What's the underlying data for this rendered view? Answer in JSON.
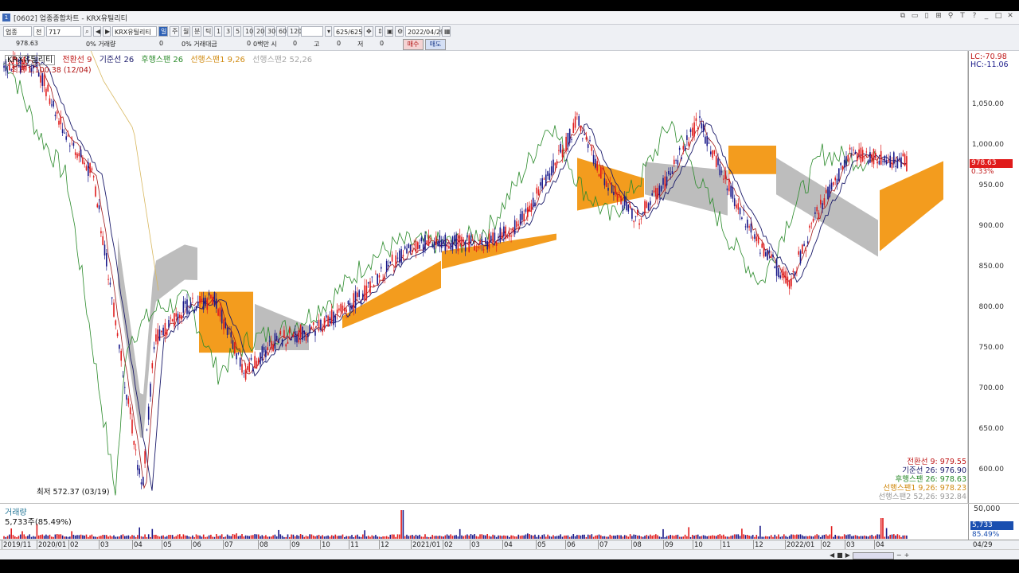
{
  "window": {
    "title": "[0602] 업종종합차트 - KRX유틸리티",
    "icon_text": "1"
  },
  "toolbar": {
    "market": "업종",
    "type": "전",
    "code": "717",
    "name": "KRX유틸리티",
    "period_buttons": [
      "일",
      "주",
      "월",
      "분",
      "틱",
      "1",
      "3",
      "5",
      "10",
      "20",
      "30",
      "60",
      "120"
    ],
    "count_display": "625/625",
    "date": "2022/04/29"
  },
  "toolbar2": {
    "price": "978.63",
    "vol_pct": "0% 거래량",
    "vol": "0",
    "amt_pct": "0% 거래대금",
    "amt": "0",
    "unit_label": "0백만 시",
    "open": "0",
    "high_label": "고",
    "high": "0",
    "low_label": "저",
    "low": "0",
    "buy": "매수",
    "sell": "매도"
  },
  "legend": {
    "name": "KRX유틸리티",
    "tenkan": "전환선 9",
    "kijun": "기준선 26",
    "chikou": "후행스팬 26",
    "senkou1": "선행스팬1 9,26",
    "senkou2": "선행스팬2 52,26"
  },
  "annotations": {
    "high": "최고 1,100.38 (12/04)",
    "low": "최저 572.37 (03/19)"
  },
  "right_top": {
    "lc": "LC:-70.98",
    "hc": "HC:-11.06"
  },
  "price_tag": {
    "value": "978.63",
    "pct": "0.33%"
  },
  "y_ticks": [
    "1,050.00",
    "1,000.00",
    "950.00",
    "900.00",
    "850.00",
    "800.00",
    "750.00",
    "700.00",
    "650.00",
    "600.00"
  ],
  "indicator_values": [
    {
      "text": "전환선 9: 979.55",
      "color": "#c01818"
    },
    {
      "text": "기준선 26: 976.90",
      "color": "#1a1a6a"
    },
    {
      "text": "후행스팬 26: 978.63",
      "color": "#2a8a2a"
    },
    {
      "text": "선행스팬1 9,26: 978.23",
      "color": "#d08a10"
    },
    {
      "text": "선행스팬2 52,26: 932.84",
      "color": "#9a9a9a"
    }
  ],
  "volume": {
    "title": "거래량",
    "value_text": "5,733주(85.49%)",
    "y_tick": "50,000",
    "box": "5,733",
    "pct": "85.49%"
  },
  "x_labels": [
    "2019/11",
    "2020/01",
    "02",
    "03",
    "04",
    "05",
    "06",
    "07",
    "08",
    "09",
    "10",
    "11",
    "12",
    "2021/01",
    "02",
    "03",
    "04",
    "05",
    "06",
    "07",
    "08",
    "09",
    "10",
    "11",
    "12",
    "2022/01",
    "02",
    "03",
    "04"
  ],
  "x_right": "04/29",
  "colors": {
    "up": "#e01b1b",
    "down": "#1a1a8a",
    "cloud_up": "#f39c1e",
    "cloud_down": "#bdbdbd",
    "chikou": "#2a8a2a",
    "kijun": "#1a1a6a",
    "senkou1": "#d8b860"
  },
  "chart_data": {
    "type": "line",
    "title": "KRX유틸리티",
    "x_range": [
      "2019/11",
      "2022/04/29"
    ],
    "ylim": [
      572.37,
      1100.38
    ],
    "series": [
      {
        "name": "KRX유틸리티",
        "points": [
          [
            "2019/12/04",
            1100.38
          ],
          [
            "2020/01",
            1020
          ],
          [
            "2020/02",
            960
          ],
          [
            "2020/03/19",
            572.37
          ],
          [
            "2020/04",
            760
          ],
          [
            "2020/05",
            800
          ],
          [
            "2020/06",
            810
          ],
          [
            "2020/07",
            720
          ],
          [
            "2020/08",
            760
          ],
          [
            "2020/09",
            770
          ],
          [
            "2020/10",
            790
          ],
          [
            "2020/11",
            820
          ],
          [
            "2020/12",
            860
          ],
          [
            "2021/01",
            880
          ],
          [
            "2021/02",
            880
          ],
          [
            "2021/03",
            880
          ],
          [
            "2021/04",
            900
          ],
          [
            "2021/05",
            960
          ],
          [
            "2021/06",
            1030
          ],
          [
            "2021/07",
            950
          ],
          [
            "2021/08",
            910
          ],
          [
            "2021/09",
            960
          ],
          [
            "2021/10",
            1030
          ],
          [
            "2021/11",
            950
          ],
          [
            "2021/12",
            880
          ],
          [
            "2022/01",
            830
          ],
          [
            "2022/02",
            920
          ],
          [
            "2022/03",
            990
          ],
          [
            "2022/04/29",
            978.63
          ]
        ]
      }
    ]
  }
}
